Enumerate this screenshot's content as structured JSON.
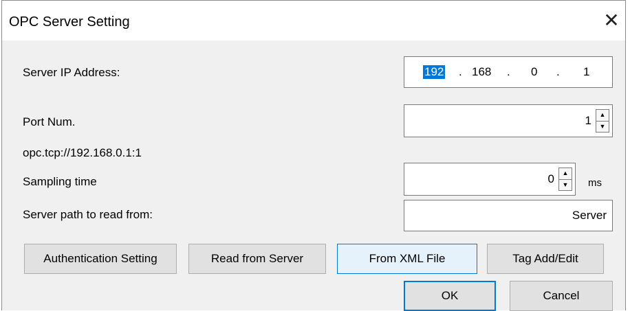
{
  "window": {
    "title": "OPC Server Setting"
  },
  "server_ip": {
    "label": "Server IP Address:",
    "octets": [
      "192",
      "168",
      "0",
      "1"
    ],
    "separator": "."
  },
  "port": {
    "label": "Port Num.",
    "value": "1"
  },
  "endpoint_url": "opc.tcp://192.168.0.1:1",
  "sampling": {
    "label": "Sampling time",
    "value": "0",
    "unit": "ms"
  },
  "server_path": {
    "label": "Server path to read from:",
    "value": "Server"
  },
  "buttons": {
    "auth": "Authentication Setting",
    "read": "Read from Server",
    "xml": "From XML File",
    "tag": "Tag Add/Edit",
    "ok": "OK",
    "cancel": "Cancel"
  },
  "icons": {
    "close": "close-icon",
    "spin_up": "up-arrow-icon",
    "spin_down": "down-arrow-icon"
  },
  "colors": {
    "selection": "#0078d7",
    "dialog_bg": "#f0f0f0",
    "focus_border": "#0078d7"
  }
}
